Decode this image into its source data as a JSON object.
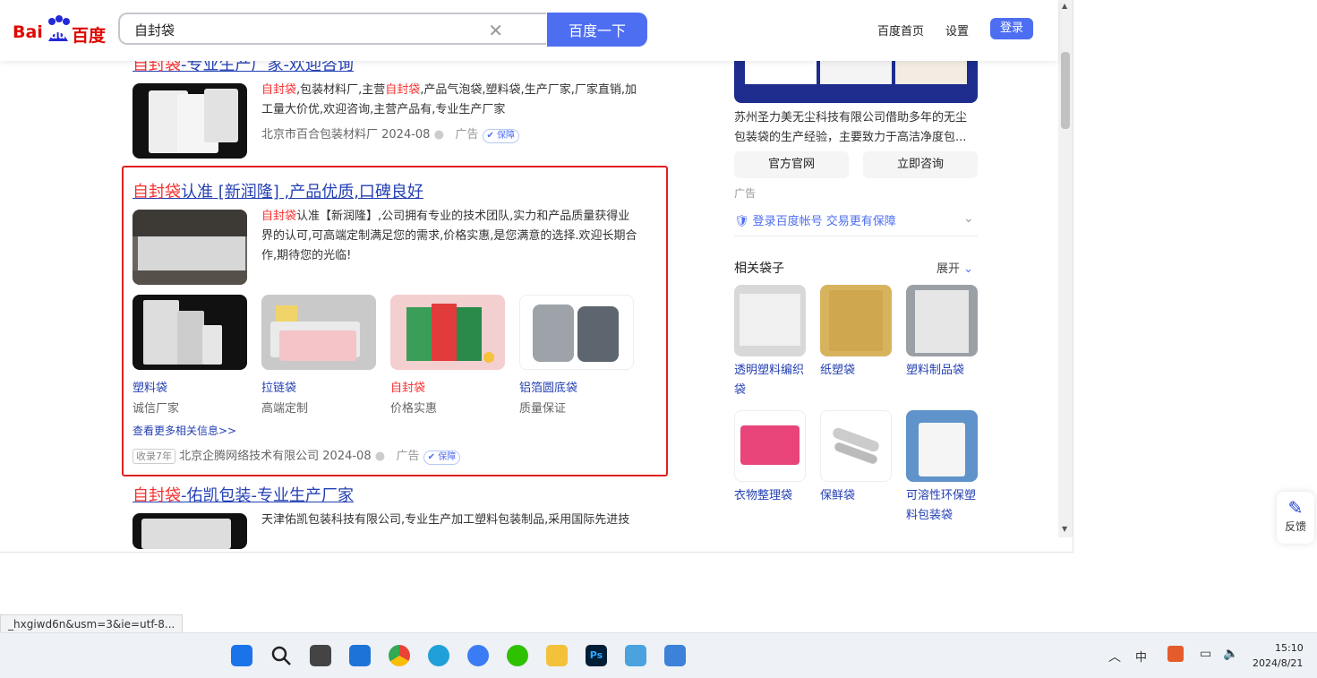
{
  "header": {
    "logo_left": "Bai",
    "logo_mid": "du",
    "logo_right": "百度",
    "search_value": "自封袋",
    "search_button": "百度一下",
    "home_link": "百度首页",
    "settings_link": "设置",
    "login_button": "登录"
  },
  "results": [
    {
      "title_hl": "自封袋",
      "title_rest": "-专业生产厂家-欢迎咨询",
      "desc_parts": [
        "自封袋",
        ",包装材料厂,主营",
        "自封袋",
        ",产品气泡袋,塑料袋,生产厂家,厂家直销,加工量大价优,欢迎咨询,主营产品有,专业生产厂家"
      ],
      "source": "北京市百合包装材料厂 2024-08",
      "ad": "广告",
      "bao": "保障"
    },
    {
      "title_hl": "自封袋",
      "title_rest": "认准 [新润隆] ,产品优质,口碑良好",
      "desc_hl": "自封袋",
      "desc_rest": "认准【新润隆】,公司拥有专业的技术团队,实力和产品质量获得业界的认可,可高端定制满足您的需求,价格实惠,是您满意的选择.欢迎长期合作,期待您的光临!",
      "subs": [
        {
          "label": "塑料袋",
          "sub": "诚信厂家"
        },
        {
          "label": "拉链袋",
          "sub": "高端定制"
        },
        {
          "label": "自封袋",
          "sub": "价格实惠"
        },
        {
          "label": "铝箔圆底袋",
          "sub": "质量保证"
        }
      ],
      "more": "查看更多相关信息>>",
      "record": "收录7年",
      "source": "北京企腾网络技术有限公司 2024-08",
      "ad": "广告",
      "bao": "保障"
    },
    {
      "title_hl": "自封袋",
      "title_rest": "-佑凯包装-专业生产厂家",
      "desc": "天津佑凯包装科技有限公司,专业生产加工塑料包装制品,采用国际先进技"
    }
  ],
  "right": {
    "company_desc": "苏州圣力美无尘科技有限公司借助多年的无尘包装袋的生产经验，主要致力于高洁净度包...",
    "btn_official": "官方官网",
    "btn_consult": "立即咨询",
    "ad": "广告",
    "login_tip": "登录百度帐号 交易更有保障",
    "related_title": "相关袋子",
    "expand": "展开",
    "related": [
      {
        "label": "透明塑料编织袋"
      },
      {
        "label": "纸塑袋"
      },
      {
        "label": "塑料制品袋"
      },
      {
        "label": "衣物整理袋"
      },
      {
        "label": "保鲜袋"
      },
      {
        "label": "可溶性环保塑料包装袋"
      }
    ]
  },
  "feedback": "反馈",
  "status_url": "_hxgiwd6n&usm=3&ie=utf-8...",
  "taskbar": {
    "time": "15:10",
    "date": "2024/8/21",
    "ime": "中"
  },
  "colors": {
    "accent": "#4e6ef2",
    "highlight": "#f73131",
    "link": "#2440b3",
    "redbox": "#e02020"
  }
}
